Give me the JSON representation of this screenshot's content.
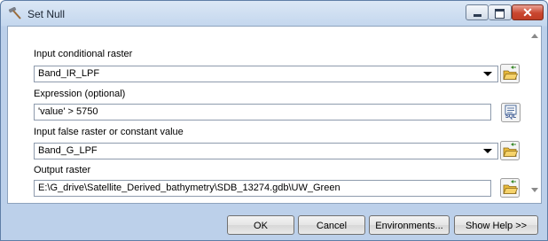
{
  "window": {
    "title": "Set Null",
    "close_glyph": "✕",
    "icons": {
      "app": "hammer-tool-icon",
      "minimize": "minimize-icon",
      "maximize": "maximize-icon",
      "close": "close-icon"
    }
  },
  "form": {
    "input_conditional_raster": {
      "label": "Input conditional raster",
      "value": "Band_IR_LPF",
      "browse_icon": "folder-browse-icon"
    },
    "expression": {
      "label": "Expression (optional)",
      "value": "'value' > 5750",
      "button_icon": "sql-query-icon",
      "button_text": "SQL"
    },
    "input_false": {
      "label": "Input false raster or constant value",
      "value": "Band_G_LPF",
      "browse_icon": "folder-browse-icon"
    },
    "output_raster": {
      "label": "Output raster",
      "value": "E:\\G_drive\\Satellite_Derived_bathymetry\\SDB_13274.gdb\\UW_Green",
      "browse_icon": "folder-browse-icon"
    }
  },
  "buttons": {
    "ok": "OK",
    "cancel": "Cancel",
    "environments": "Environments...",
    "show_help": "Show Help >>"
  },
  "colors": {
    "title_bar": "#c4d7ee",
    "close_button": "#c9462f",
    "folder": "#e8b93a"
  }
}
